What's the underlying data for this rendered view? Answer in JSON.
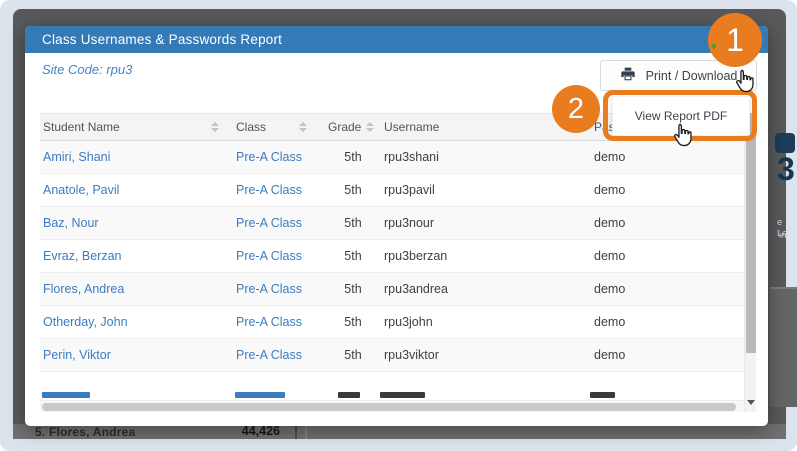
{
  "colors": {
    "header_blue": "#337ab7",
    "accent_orange": "#e87c1f",
    "link_blue": "#3b7cc0",
    "backdrop_gray": "#58595b"
  },
  "modal": {
    "title": "Class Usernames & Passwords Report",
    "close": "×",
    "site_code": "Site Code: rpu3",
    "print_button": {
      "label": "Print / Download",
      "caret": "▾"
    },
    "dropdown": {
      "view_pdf": "View Report PDF"
    },
    "table": {
      "columns": [
        "Student Name",
        "Class",
        "Grade",
        "Username",
        "Password"
      ],
      "rows": [
        {
          "name": "Amiri, Shani",
          "class": "Pre-A Class",
          "grade": "5th",
          "username": "rpu3shani",
          "password": "demo"
        },
        {
          "name": "Anatole, Pavil",
          "class": "Pre-A Class",
          "grade": "5th",
          "username": "rpu3pavil",
          "password": "demo"
        },
        {
          "name": "Baz, Nour",
          "class": "Pre-A Class",
          "grade": "5th",
          "username": "rpu3nour",
          "password": "demo"
        },
        {
          "name": "Evraz, Berzan",
          "class": "Pre-A Class",
          "grade": "5th",
          "username": "rpu3berzan",
          "password": "demo"
        },
        {
          "name": "Flores, Andrea",
          "class": "Pre-A Class",
          "grade": "5th",
          "username": "rpu3andrea",
          "password": "demo"
        },
        {
          "name": "Otherday, John",
          "class": "Pre-A Class",
          "grade": "5th",
          "username": "rpu3john",
          "password": "demo"
        },
        {
          "name": "Perin, Viktor",
          "class": "Pre-A Class",
          "grade": "5th",
          "username": "rpu3viktor",
          "password": "demo"
        }
      ]
    }
  },
  "annotations": {
    "step1": "1",
    "step2": "2"
  },
  "background": {
    "leaderboard_rank_row": "5. Flores, Andrea",
    "leaderboard_value": "44,426",
    "logo_digit": "3",
    "side_text_line1": "e Le",
    "side_text_line2": "in"
  }
}
